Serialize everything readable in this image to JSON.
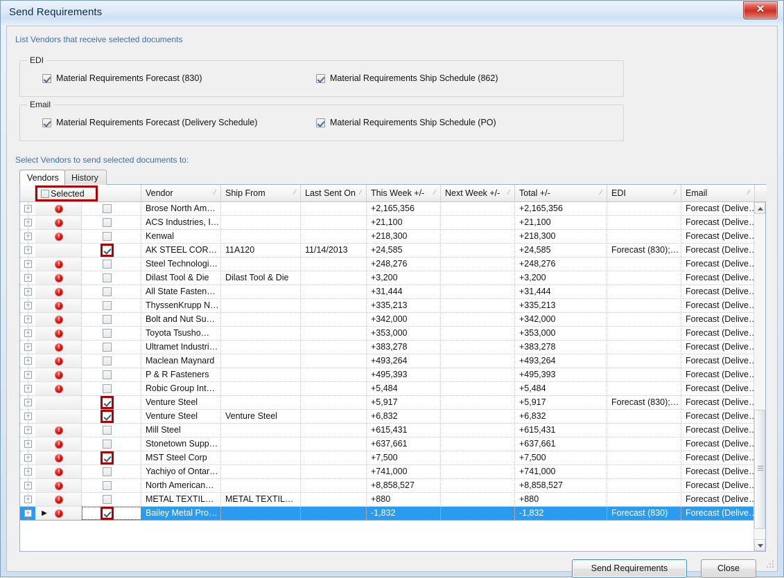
{
  "window": {
    "title": "Send Requirements",
    "close_label": "✕"
  },
  "hints": {
    "top": "List Vendors that receive selected documents",
    "middle": "Select Vendors to send selected documents to:"
  },
  "groups": [
    {
      "legend": "EDI",
      "options": [
        {
          "label": "Material Requirements Forecast (830)",
          "checked": true
        },
        {
          "label": "Material Requirements Ship Schedule (862)",
          "checked": true
        }
      ]
    },
    {
      "legend": "Email",
      "options": [
        {
          "label": "Material Requirements Forecast (Delivery Schedule)",
          "checked": true
        },
        {
          "label": "Material Requirements Ship Schedule (PO)",
          "checked": true
        }
      ]
    }
  ],
  "tabs": [
    {
      "label": "Vendors",
      "active": true
    },
    {
      "label": "History",
      "active": false
    }
  ],
  "grid": {
    "select_all_header": {
      "label": "Selected",
      "checked": false,
      "highlighted": true
    },
    "columns": [
      {
        "label": "Vendor",
        "sortable": true
      },
      {
        "label": "Ship From",
        "sortable": true
      },
      {
        "label": "Last Sent On",
        "sortable": true
      },
      {
        "label": "This Week +/-",
        "sortable": true
      },
      {
        "label": "Next Week +/-",
        "sortable": true
      },
      {
        "label": "Total +/-",
        "sortable": true
      },
      {
        "label": "EDI",
        "sortable": true
      },
      {
        "label": "Email",
        "sortable": true
      }
    ],
    "rows": [
      {
        "error": true,
        "selected": false,
        "vendor": "Brose North Am…",
        "ship_from": "",
        "last_sent_on": "",
        "this_week": "+2,165,356",
        "next_week": "",
        "total": "+2,165,356",
        "edi": "",
        "email": "Forecast  (Delive…",
        "current": false
      },
      {
        "error": true,
        "selected": false,
        "vendor": "ACS Industries, I…",
        "ship_from": "",
        "last_sent_on": "",
        "this_week": "+21,100",
        "next_week": "",
        "total": "+21,100",
        "edi": "",
        "email": "Forecast  (Delive…",
        "current": false
      },
      {
        "error": true,
        "selected": false,
        "vendor": "Kenwal",
        "ship_from": "",
        "last_sent_on": "",
        "this_week": "+218,300",
        "next_week": "",
        "total": "+218,300",
        "edi": "",
        "email": "Forecast  (Delive…",
        "current": false
      },
      {
        "error": false,
        "selected": true,
        "vendor": "AK STEEL COR…",
        "ship_from": "11A120",
        "last_sent_on": "11/14/2013",
        "this_week": "+24,585",
        "next_week": "",
        "total": "+24,585",
        "edi": "Forecast  (830);…",
        "email": "Forecast  (Delive…",
        "current": false
      },
      {
        "error": true,
        "selected": false,
        "vendor": "Steel  Technologi…",
        "ship_from": "",
        "last_sent_on": "",
        "this_week": "+248,276",
        "next_week": "",
        "total": "+248,276",
        "edi": "",
        "email": "Forecast  (Delive…",
        "current": false
      },
      {
        "error": true,
        "selected": false,
        "vendor": "Dilast Tool & Die",
        "ship_from": "Dilast Tool & Die",
        "last_sent_on": "",
        "this_week": "+3,200",
        "next_week": "",
        "total": "+3,200",
        "edi": "",
        "email": "Forecast  (Delive…",
        "current": false
      },
      {
        "error": true,
        "selected": false,
        "vendor": "All State Fasten…",
        "ship_from": "",
        "last_sent_on": "",
        "this_week": "+31,444",
        "next_week": "",
        "total": "+31,444",
        "edi": "",
        "email": "Forecast  (Delive…",
        "current": false
      },
      {
        "error": true,
        "selected": false,
        "vendor": "ThyssenKrupp  N…",
        "ship_from": "",
        "last_sent_on": "",
        "this_week": "+335,213",
        "next_week": "",
        "total": "+335,213",
        "edi": "",
        "email": "Forecast  (Delive…",
        "current": false
      },
      {
        "error": true,
        "selected": false,
        "vendor": "Bolt and Nut Su…",
        "ship_from": "",
        "last_sent_on": "",
        "this_week": "+342,000",
        "next_week": "",
        "total": "+342,000",
        "edi": "",
        "email": "Forecast  (Delive…",
        "current": false
      },
      {
        "error": true,
        "selected": false,
        "vendor": "Toyota Tsusho…",
        "ship_from": "",
        "last_sent_on": "",
        "this_week": "+353,000",
        "next_week": "",
        "total": "+353,000",
        "edi": "",
        "email": "Forecast  (Delive…",
        "current": false
      },
      {
        "error": true,
        "selected": false,
        "vendor": "Ultramet  Industri…",
        "ship_from": "",
        "last_sent_on": "",
        "this_week": "+383,278",
        "next_week": "",
        "total": "+383,278",
        "edi": "",
        "email": "Forecast  (Delive…",
        "current": false
      },
      {
        "error": true,
        "selected": false,
        "vendor": "Maclean Maynard",
        "ship_from": "",
        "last_sent_on": "",
        "this_week": "+493,264",
        "next_week": "",
        "total": "+493,264",
        "edi": "",
        "email": "Forecast  (Delive…",
        "current": false
      },
      {
        "error": true,
        "selected": false,
        "vendor": "P & R Fasteners",
        "ship_from": "",
        "last_sent_on": "",
        "this_week": "+495,393",
        "next_week": "",
        "total": "+495,393",
        "edi": "",
        "email": "Forecast  (Delive…",
        "current": false
      },
      {
        "error": true,
        "selected": false,
        "vendor": "Robic  Group  Int…",
        "ship_from": "",
        "last_sent_on": "",
        "this_week": "+5,484",
        "next_week": "",
        "total": "+5,484",
        "edi": "",
        "email": "Forecast  (Delive…",
        "current": false
      },
      {
        "error": false,
        "selected": true,
        "vendor": "Venture Steel",
        "ship_from": "",
        "last_sent_on": "",
        "this_week": "+5,917",
        "next_week": "",
        "total": "+5,917",
        "edi": "Forecast  (830);…",
        "email": "Forecast  (Delive…",
        "current": false
      },
      {
        "error": false,
        "selected": true,
        "vendor": "Venture Steel",
        "ship_from": "Venture Steel",
        "last_sent_on": "",
        "this_week": "+6,832",
        "next_week": "",
        "total": "+6,832",
        "edi": "",
        "email": "Forecast  (Delive…",
        "current": false
      },
      {
        "error": true,
        "selected": false,
        "vendor": "Mill Steel",
        "ship_from": "",
        "last_sent_on": "",
        "this_week": "+615,431",
        "next_week": "",
        "total": "+615,431",
        "edi": "",
        "email": "Forecast  (Delive…",
        "current": false
      },
      {
        "error": true,
        "selected": false,
        "vendor": "Stonetown  Supp…",
        "ship_from": "",
        "last_sent_on": "",
        "this_week": "+637,661",
        "next_week": "",
        "total": "+637,661",
        "edi": "",
        "email": "Forecast  (Delive…",
        "current": false
      },
      {
        "error": true,
        "selected": true,
        "vendor": "MST Steel Corp",
        "ship_from": "",
        "last_sent_on": "",
        "this_week": "+7,500",
        "next_week": "",
        "total": "+7,500",
        "edi": "",
        "email": "Forecast  (Delive…",
        "current": false
      },
      {
        "error": true,
        "selected": false,
        "vendor": "Yachiyo of Ontar…",
        "ship_from": "",
        "last_sent_on": "",
        "this_week": "+741,000",
        "next_week": "",
        "total": "+741,000",
        "edi": "",
        "email": "Forecast  (Delive…",
        "current": false
      },
      {
        "error": true,
        "selected": false,
        "vendor": "North  American…",
        "ship_from": "",
        "last_sent_on": "",
        "this_week": "+8,858,527",
        "next_week": "",
        "total": "+8,858,527",
        "edi": "",
        "email": "Forecast  (Delive…",
        "current": false
      },
      {
        "error": true,
        "selected": false,
        "vendor": "METAL  TEXTIL…",
        "ship_from": "METAL  TEXTIL…",
        "last_sent_on": "",
        "this_week": "+880",
        "next_week": "",
        "total": "+880",
        "edi": "",
        "email": "Forecast  (Delive…",
        "current": false
      },
      {
        "error": true,
        "selected": true,
        "vendor": "Bailey  Metal Pro…",
        "ship_from": "",
        "last_sent_on": "",
        "this_week": "-1,832",
        "next_week": "",
        "total": "-1,832",
        "edi": "Forecast (830)",
        "email": "Forecast  (Delive…",
        "current": true
      }
    ],
    "scrollbar": {
      "up_icon": "scroll-up-arrow",
      "down_icon": "scroll-down-arrow"
    }
  },
  "footer": {
    "send_label": "Send Requirements",
    "close_label": "Close"
  },
  "colors": {
    "accent_link": "#3a6fb5",
    "selection": "#2a9bf0",
    "annotation_red": "#b00000",
    "error_red": "#d50000"
  }
}
